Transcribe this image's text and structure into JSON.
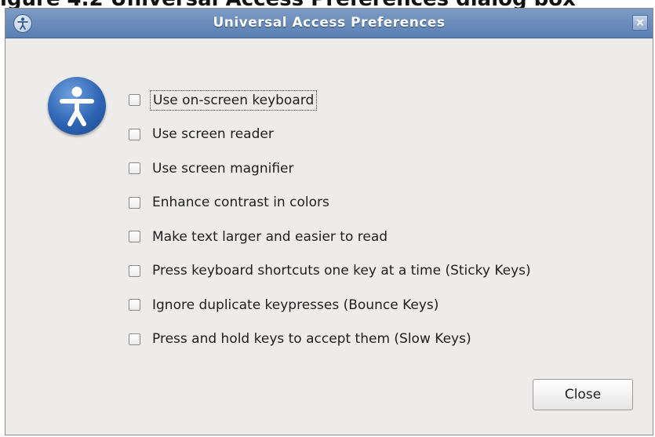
{
  "caption": "igure 4.2 Universal Access Preferences dialog box",
  "window": {
    "title": "Universal Access Preferences",
    "close_glyph": "×"
  },
  "options": [
    {
      "label": "Use on-screen keyboard",
      "checked": false
    },
    {
      "label": "Use screen reader",
      "checked": false
    },
    {
      "label": "Use screen magnifier",
      "checked": false
    },
    {
      "label": "Enhance contrast in colors",
      "checked": false
    },
    {
      "label": "Make text larger and easier to read",
      "checked": false
    },
    {
      "label": "Press keyboard shortcuts one key at a time (Sticky Keys)",
      "checked": false
    },
    {
      "label": "Ignore duplicate keypresses (Bounce Keys)",
      "checked": false
    },
    {
      "label": "Press and hold keys to accept them (Slow Keys)",
      "checked": false
    }
  ],
  "buttons": {
    "close_label": "Close"
  },
  "colors": {
    "titlebar": "#5a7fb3",
    "accent": "#2e64b4"
  }
}
